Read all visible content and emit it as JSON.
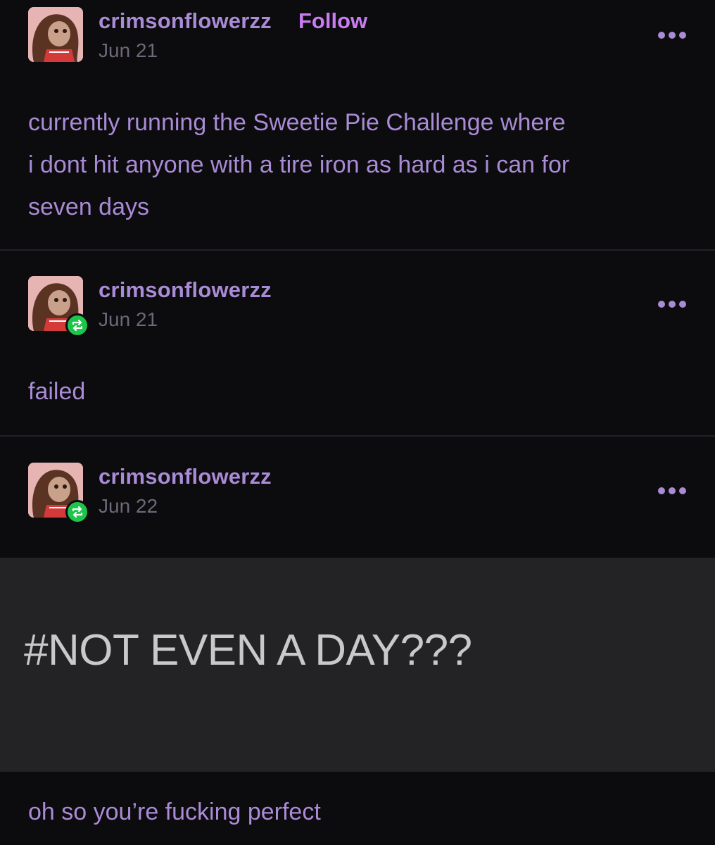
{
  "posts": [
    {
      "username": "crimsonflowerzz",
      "follow_label": "Follow",
      "date": "Jun 21",
      "body_lines": [
        "currently running the Sweetie Pie Challenge where",
        "i dont hit anyone with a tire iron as hard as i can for",
        "seven days"
      ]
    },
    {
      "username": "crimsonflowerzz",
      "date": "Jun 21",
      "body": "failed"
    },
    {
      "username": "crimsonflowerzz",
      "date": "Jun 22",
      "tag": "#NOT EVEN A DAY???"
    }
  ],
  "footer_reply": "oh so you’re fucking perfect",
  "colors": {
    "background": "#0c0b0d",
    "text_purple": "#a98bd6",
    "follow_purple": "#c97bf0",
    "date_gray": "#6e6878",
    "tag_panel": "#232225",
    "reblog_green": "#1bc64a"
  },
  "icons": {
    "reblog": "reblog-icon",
    "more": "more-options-icon"
  }
}
